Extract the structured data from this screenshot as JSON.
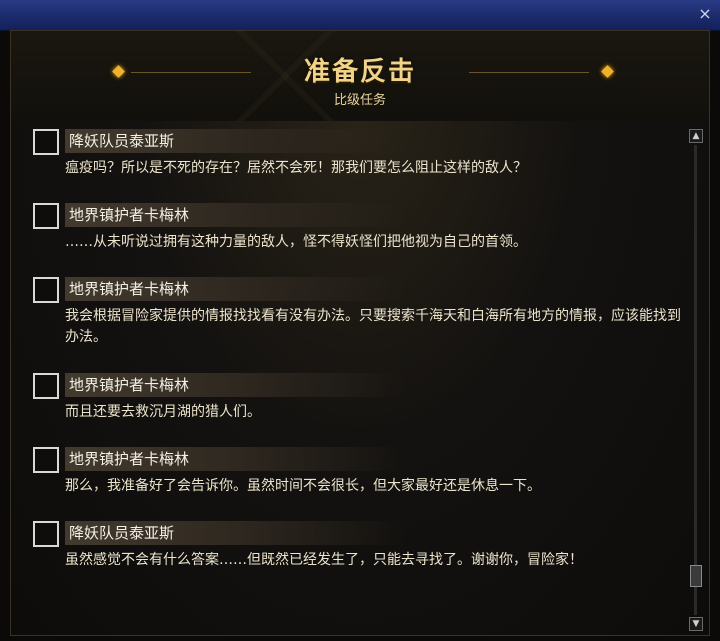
{
  "window": {
    "close_symbol": "×"
  },
  "header": {
    "title": "准备反击",
    "subtitle": "比级任务"
  },
  "dialogue": [
    {
      "speaker": "降妖队员泰亚斯",
      "text": "瘟疫吗？所以是不死的存在？居然不会死！那我们要怎么阻止这样的敌人？"
    },
    {
      "speaker": "地界镇护者卡梅林",
      "text": "……从未听说过拥有这种力量的敌人，怪不得妖怪们把他视为自己的首领。"
    },
    {
      "speaker": "地界镇护者卡梅林",
      "text": "我会根据冒险家提供的情报找找看有没有办法。只要搜索千海天和白海所有地方的情报，应该能找到办法。"
    },
    {
      "speaker": "地界镇护者卡梅林",
      "text": "而且还要去救沉月湖的猎人们。"
    },
    {
      "speaker": "地界镇护者卡梅林",
      "text": "那么，我准备好了会告诉你。虽然时间不会很长，但大家最好还是休息一下。"
    },
    {
      "speaker": "降妖队员泰亚斯",
      "text": "虽然感觉不会有什么答案……但既然已经发生了，只能去寻找了。谢谢你，冒险家！"
    }
  ],
  "scrollbar": {
    "up_symbol": "▲",
    "down_symbol": "▼",
    "position": 0.92
  },
  "colors": {
    "title": "#f2d38a",
    "accent": "#f0b030",
    "titlebar": "#1a2a6a"
  }
}
